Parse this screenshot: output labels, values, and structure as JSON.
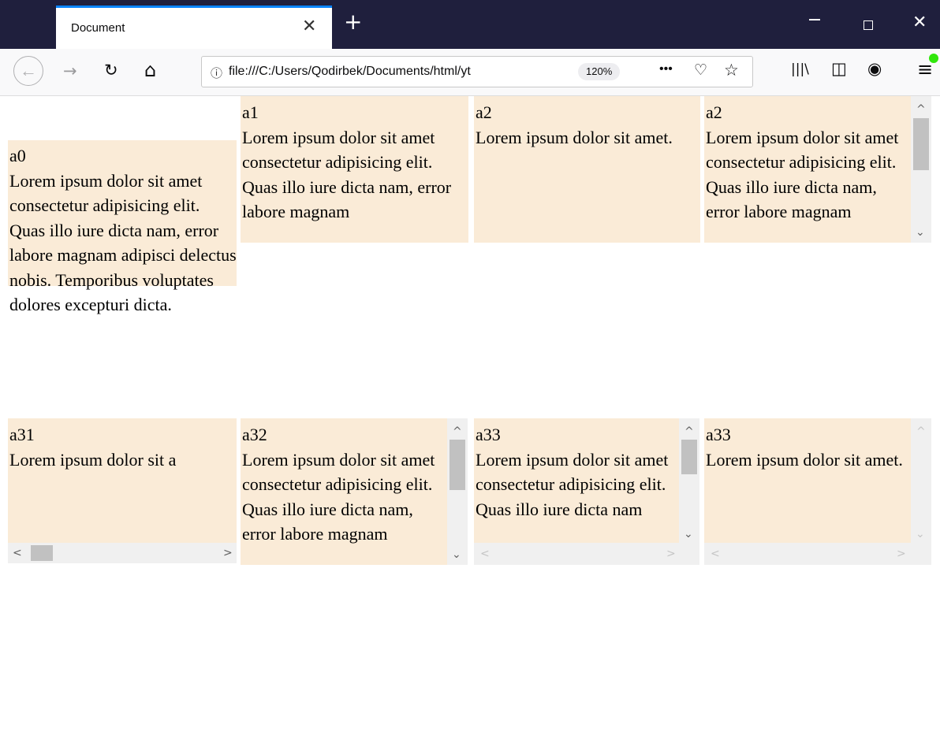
{
  "browser": {
    "tab_title": "Document",
    "tab_close": "✕",
    "new_tab": "+",
    "url": "file:///C:/Users/Qodirbek/Documents/html/yt",
    "zoom": "120%",
    "more": "•••",
    "icons": {
      "back": "back-arrow-icon",
      "forward": "forward-arrow-icon",
      "reload": "reload-icon",
      "home": "home-icon",
      "info": "info-icon",
      "pocket": "pocket-icon",
      "star": "bookmark-star-icon",
      "library": "library-icon",
      "sidebar": "sidebar-icon",
      "account": "account-icon",
      "menu": "hamburger-menu-icon"
    },
    "glyphs": {
      "back": "←",
      "forward": "→",
      "reload": "↻",
      "home": "⌂",
      "info": "ⓘ",
      "pocket": "♡",
      "star": "☆",
      "library": "|||\\",
      "sidebar": "◫",
      "account": "◉",
      "menu": "≡",
      "minimize": "—",
      "close": "✕"
    },
    "colors": {
      "tab_accent": "#0a84ff",
      "titlebar": "#1f1f3d",
      "update_badge": "#30e60b"
    }
  },
  "page": {
    "cell_background": "#faebd7",
    "cells": [
      {
        "label": "a0",
        "text": "Lorem ipsum dolor sit amet consectetur adipisicing elit. Quas illo iure dicta nam, error labore magnam adipisci delectus nobis. Temporibus voluptates dolores excepturi dicta."
      },
      {
        "label": "a1",
        "text": "Lorem ipsum dolor sit amet consectetur adipisicing elit. Quas illo iure dicta nam, error labore magnam"
      },
      {
        "label": "a2",
        "text": "Lorem ipsum dolor sit amet."
      },
      {
        "label": "a2",
        "text": "Lorem ipsum dolor sit amet consectetur adipisicing elit. Quas illo iure dicta nam, error labore magnam"
      },
      {
        "label": "a31",
        "text": "Lorem ipsum dolor sit a"
      },
      {
        "label": "a32",
        "text": "Lorem ipsum dolor sit amet consectetur adipisicing elit. Quas illo iure dicta nam, error labore magnam"
      },
      {
        "label": "a33",
        "text": "Lorem ipsum dolor sit amet consectetur adipisicing elit. Quas illo iure dicta nam"
      },
      {
        "label": "a33",
        "text": "Lorem ipsum dolor sit amet."
      }
    ],
    "scroll_glyphs": {
      "up": "^",
      "down": "⌄",
      "left": "<",
      "right": ">"
    }
  }
}
